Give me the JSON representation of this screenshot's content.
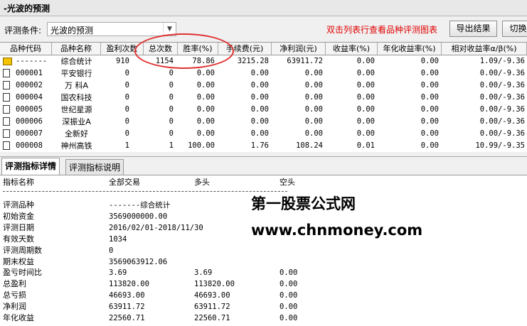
{
  "window": {
    "title": "-光波的预测"
  },
  "condition": {
    "label": "评测条件:",
    "selected": "光波的预测",
    "hint": "双击列表行查看品种评测图表",
    "export_button": "导出结果",
    "switch_button": "切换"
  },
  "grid": {
    "headers": [
      "品种代码",
      "品种名称",
      "盈利次数",
      "总次数",
      "胜率(%)",
      "手续费(元)",
      "净利润(元)",
      "收益率(%)",
      "年化收益率(%)",
      "相对收益率α/β(%)"
    ],
    "rows": [
      {
        "code": "-------",
        "name": "综合统计",
        "win": "910",
        "total": "1154",
        "rate": "78.86",
        "fee": "3215.28",
        "profit": "63911.72",
        "ret": "0.00",
        "annual": "0.00",
        "rel": "1.09/-9.36",
        "summary": true
      },
      {
        "code": "000001",
        "name": "平安银行",
        "win": "0",
        "total": "0",
        "rate": "0.00",
        "fee": "0.00",
        "profit": "0.00",
        "ret": "0.00",
        "annual": "0.00",
        "rel": "0.00/-9.36"
      },
      {
        "code": "000002",
        "name": "万 科A",
        "win": "0",
        "total": "0",
        "rate": "0.00",
        "fee": "0.00",
        "profit": "0.00",
        "ret": "0.00",
        "annual": "0.00",
        "rel": "0.00/-9.36"
      },
      {
        "code": "000004",
        "name": "国农科技",
        "win": "0",
        "total": "0",
        "rate": "0.00",
        "fee": "0.00",
        "profit": "0.00",
        "ret": "0.00",
        "annual": "0.00",
        "rel": "0.00/-9.36"
      },
      {
        "code": "000005",
        "name": "世纪星源",
        "win": "0",
        "total": "0",
        "rate": "0.00",
        "fee": "0.00",
        "profit": "0.00",
        "ret": "0.00",
        "annual": "0.00",
        "rel": "0.00/-9.36"
      },
      {
        "code": "000006",
        "name": "深振业A",
        "win": "0",
        "total": "0",
        "rate": "0.00",
        "fee": "0.00",
        "profit": "0.00",
        "ret": "0.00",
        "annual": "0.00",
        "rel": "0.00/-9.36"
      },
      {
        "code": "000007",
        "name": "全新好",
        "win": "0",
        "total": "0",
        "rate": "0.00",
        "fee": "0.00",
        "profit": "0.00",
        "ret": "0.00",
        "annual": "0.00",
        "rel": "0.00/-9.36"
      },
      {
        "code": "000008",
        "name": "神州高铁",
        "win": "1",
        "total": "1",
        "rate": "100.00",
        "fee": "1.76",
        "profit": "108.24",
        "ret": "0.01",
        "annual": "0.00",
        "rel": "10.99/-9.35"
      }
    ]
  },
  "tabs": [
    "评测指标详情",
    "评测指标说明"
  ],
  "detail": {
    "headers": [
      "指标名称",
      "全部交易",
      "多头",
      "空头"
    ],
    "rows": [
      {
        "name": "评测品种",
        "all": "-------综合统计",
        "long": "",
        "short": ""
      },
      {
        "name": "初始资金",
        "all": "3569000000.00",
        "long": "",
        "short": ""
      },
      {
        "name": "评测日期",
        "all": "2016/02/01-2018/11/30",
        "long": "",
        "short": ""
      },
      {
        "name": "有效天数",
        "all": "1034",
        "long": "",
        "short": ""
      },
      {
        "name": "评测周期数",
        "all": "0",
        "long": "",
        "short": ""
      },
      {
        "name": "期末权益",
        "all": "3569063912.06",
        "long": "",
        "short": ""
      },
      {
        "name": "盈亏时间比",
        "all": "3.69",
        "long": "3.69",
        "short": "0.00"
      },
      {
        "name": "总盈利",
        "all": "113820.00",
        "long": "113820.00",
        "short": "0.00"
      },
      {
        "name": "总亏损",
        "all": "46693.00",
        "long": "46693.00",
        "short": "0.00"
      },
      {
        "name": "净利润",
        "all": "63911.72",
        "long": "63911.72",
        "short": "0.00"
      },
      {
        "name": "年化收益",
        "all": "22560.71",
        "long": "22560.71",
        "short": "0.00"
      }
    ]
  },
  "watermark": {
    "line1": "第一股票公式网",
    "line2": "www.chnmoney.com"
  },
  "colors": {
    "hint": "#e00000",
    "annotation_circle": "#e03030",
    "summary_icon": "#f5c400"
  }
}
